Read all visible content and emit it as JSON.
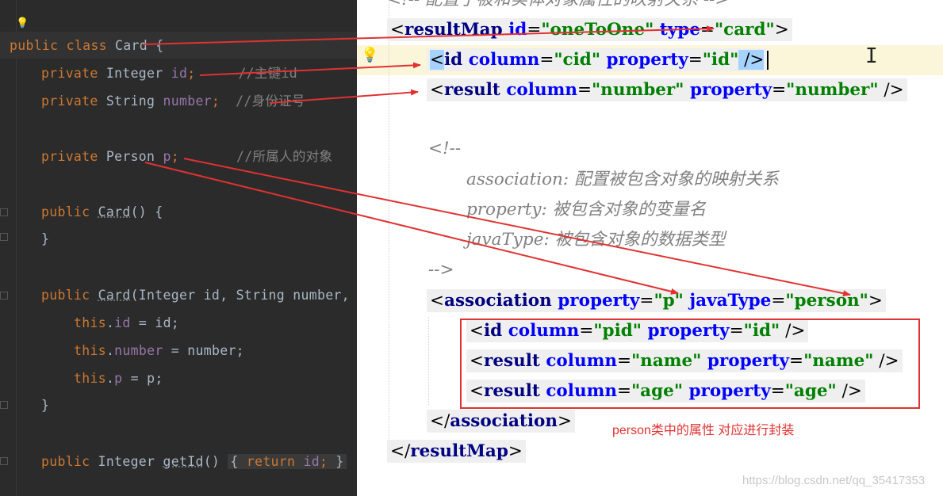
{
  "java": {
    "lines": {
      "class_decl": {
        "kw": "public class ",
        "name": "Card",
        "rest": " {"
      },
      "field_id": {
        "kw": "private ",
        "type": "Integer ",
        "name": "id",
        "semi": ";",
        "comment": "//主键id"
      },
      "field_number": {
        "kw": "private ",
        "type": "String ",
        "name": "number",
        "semi": ";",
        "comment": "//身份证号"
      },
      "field_p": {
        "kw": "private ",
        "type": "Person ",
        "name": "p",
        "semi": ";",
        "comment": "//所属人的对象"
      },
      "ctor1": {
        "kw": "public ",
        "name": "Card",
        "rest": "() {"
      },
      "close1": "}",
      "ctor2": {
        "kw": "public ",
        "name": "Card",
        "rest": "(Integer id, String number, P"
      },
      "assign_id": {
        "kw": "this",
        "dot": ".",
        "field": "id",
        "rest": " = id;"
      },
      "assign_number": {
        "kw": "this",
        "dot": ".",
        "field": "number",
        "rest": " = number;"
      },
      "assign_p": {
        "kw": "this",
        "dot": ".",
        "field": "p",
        "rest": " = p;"
      },
      "close2": "}",
      "getter": {
        "kw": "public ",
        "type": "Integer ",
        "name": "getId",
        "paren": "() ",
        "open": "{",
        "ret": " return ",
        "fld": "id",
        "semi": ";",
        "close": " }"
      }
    }
  },
  "xml": {
    "top_comment": "<!-- 配置了被和实体对象属性的映射关系 -->",
    "resultmap_open": {
      "lt": "<",
      "tag": "resultMap",
      "a1": " id",
      "eq1": "=",
      "v1": "\"oneToOne\"",
      "a2": " type",
      "eq2": "=",
      "v2": "\"card\"",
      "gt": ">"
    },
    "id_line": {
      "lt": "<",
      "tag": "id",
      "a1": " column",
      "eq1": "=",
      "v1": "\"cid\"",
      "a2": " property",
      "eq2": "=",
      "v2": "\"id\"",
      "end": " />"
    },
    "result_number": {
      "lt": "<",
      "tag": "result",
      "a1": " column",
      "eq1": "=",
      "v1": "\"number\"",
      "a2": " property",
      "eq2": "=",
      "v2": "\"number\"",
      "end": " />"
    },
    "comment_open": "<!--",
    "comment_l1": "association: 配置被包含对象的映射关系",
    "comment_l2": "property: 被包含对象的变量名",
    "comment_l3": "javaType: 被包含对象的数据类型",
    "comment_close": "-->",
    "association_open": {
      "lt": "<",
      "tag": "association",
      "a1": " property",
      "eq1": "=",
      "v1": "\"p\"",
      "a2": " javaType",
      "eq2": "=",
      "v2": "\"person\"",
      "gt": ">"
    },
    "assoc_id": {
      "lt": "<",
      "tag": "id",
      "a1": " column",
      "eq1": "=",
      "v1": "\"pid\"",
      "a2": " property",
      "eq2": "=",
      "v2": "\"id\"",
      "end": " />"
    },
    "assoc_name": {
      "lt": "<",
      "tag": "result",
      "a1": " column",
      "eq1": "=",
      "v1": "\"name\"",
      "a2": " property",
      "eq2": "=",
      "v2": "\"name\"",
      "end": " />"
    },
    "assoc_age": {
      "lt": "<",
      "tag": "result",
      "a1": " column",
      "eq1": "=",
      "v1": "\"age\"",
      "a2": " property",
      "eq2": "=",
      "v2": "\"age\"",
      "end": " />"
    },
    "association_close": {
      "lt": "</",
      "tag": "association",
      "gt": ">"
    },
    "resultmap_close": {
      "lt": "</",
      "tag": "resultMap",
      "gt": ">"
    }
  },
  "annotation": "person类中的属性 对应进行封装",
  "watermark": "https://blog.csdn.net/qq_35417353",
  "colors": {
    "dark_bg": "#2b2b2b",
    "java_keyword": "#cc7832",
    "java_field": "#9876aa",
    "java_comment": "#808080",
    "xml_tag": "#000080",
    "xml_attr": "#0000ff",
    "xml_value": "#008000",
    "arrow_red": "#e03232"
  },
  "icons": [
    "lightbulb-icon",
    "text-cursor-icon"
  ]
}
